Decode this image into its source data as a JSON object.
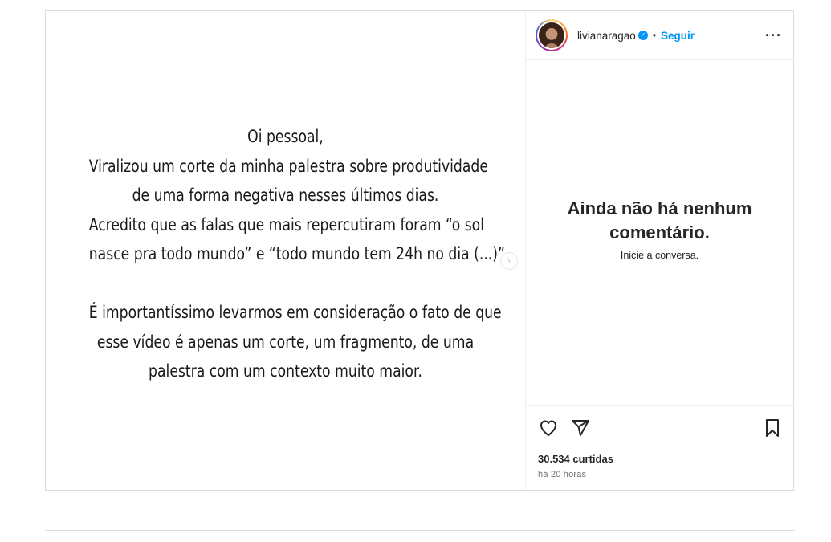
{
  "post": {
    "media_lines": [
      "Oi pessoal,",
      "Viralizou um corte da minha palestra sobre produtividade",
      "de uma forma negativa nesses últimos dias.",
      "Acredito que as falas que mais repercutiram foram “o sol",
      "nasce pra todo mundo” e “todo mundo tem 24h no dia (...)”.",
      "",
      "É importantíssimo levarmos em consideração o fato de que",
      "esse vídeo é apenas um corte, um fragmento, de uma",
      "palestra com um contexto muito maior."
    ],
    "next_icon": "chevron-right-icon"
  },
  "header": {
    "username": "livianaragao",
    "verified_icon": "verified-badge-icon",
    "separator": "•",
    "follow_label": "Seguir",
    "more_icon": "more-options-icon"
  },
  "comments": {
    "empty_title": "Ainda não há nenhum comentário.",
    "empty_subtitle": "Inicie a conversa."
  },
  "actions": {
    "like_icon": "heart-icon",
    "share_icon": "send-icon",
    "save_icon": "bookmark-icon",
    "likes_text": "30.534 curtidas",
    "timestamp": "há 20 horas"
  },
  "colors": {
    "accent": "#0095f6",
    "text": "#262626",
    "muted": "#737373",
    "border": "#dbdbdb"
  }
}
